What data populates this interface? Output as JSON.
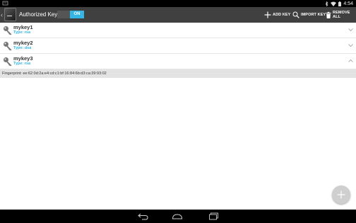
{
  "status_bar": {
    "time": "4:54",
    "icons": [
      "notification-icon",
      "bluetooth-icon",
      "wifi-icon",
      "battery-icon"
    ]
  },
  "action_bar": {
    "title": "Authorized Keys",
    "toggle_label": "ON",
    "toggle_on": true,
    "actions": [
      {
        "label": "ADD KEY",
        "icon": "plus-icon"
      },
      {
        "label": "IMPORT KEY",
        "icon": "search-icon"
      },
      {
        "label": "REMOVE ALL",
        "icon": "trash-icon"
      }
    ]
  },
  "keys": [
    {
      "name": "mykey1",
      "type": "Type: rsa",
      "expanded": false
    },
    {
      "name": "mykey2",
      "type": "Type: dsa",
      "expanded": false
    },
    {
      "name": "mykey3",
      "type": "Type: rsa",
      "expanded": true,
      "fingerprint": "Fingerprint: ee:62:0d:2a:e4:cd:c1:bf:16:84:6b:d3:ca:39:93:02"
    }
  ],
  "colors": {
    "accent": "#33b5e5",
    "action_bar": "#404040",
    "fingerprint_bg": "#e3e3e3"
  },
  "nav_bar": {
    "buttons": [
      "back-icon",
      "home-icon",
      "recents-icon"
    ]
  }
}
